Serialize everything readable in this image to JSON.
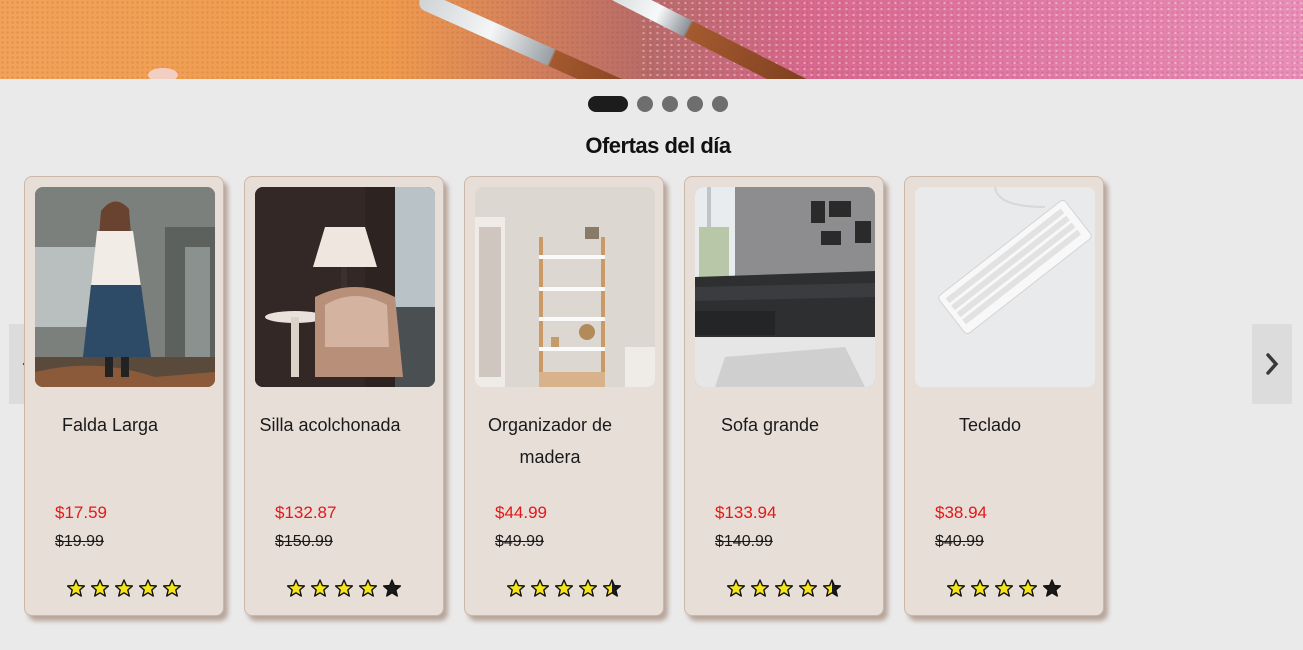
{
  "carousel": {
    "slides": 5,
    "active_index": 0
  },
  "section": {
    "title": "Ofertas del día"
  },
  "products": [
    {
      "name": "Falda Larga",
      "price": "$17.59",
      "old_price": "$19.99",
      "rating": 5,
      "image": "woman-in-skirt-photo"
    },
    {
      "name": "Silla acolchonada",
      "price": "$132.87",
      "old_price": "$150.99",
      "rating": 4,
      "image": "armchair-lamp-photo"
    },
    {
      "name": "Organizador de madera",
      "price": "$44.99",
      "old_price": "$49.99",
      "rating": 4.5,
      "image": "wooden-shelf-photo"
    },
    {
      "name": "Sofa grande",
      "price": "$133.94",
      "old_price": "$140.99",
      "rating": 4.5,
      "image": "sectional-sofa-photo"
    },
    {
      "name": "Teclado",
      "price": "$38.94",
      "old_price": "$40.99",
      "rating": 4,
      "image": "keyboard-photo"
    }
  ],
  "colors": {
    "price": "#e01818",
    "star_full": "#f5e61a",
    "star_empty": "#1a1a1a"
  },
  "icons": {
    "prev": "chevron-left-icon",
    "next": "chevron-right-icon",
    "star": "star-icon"
  }
}
